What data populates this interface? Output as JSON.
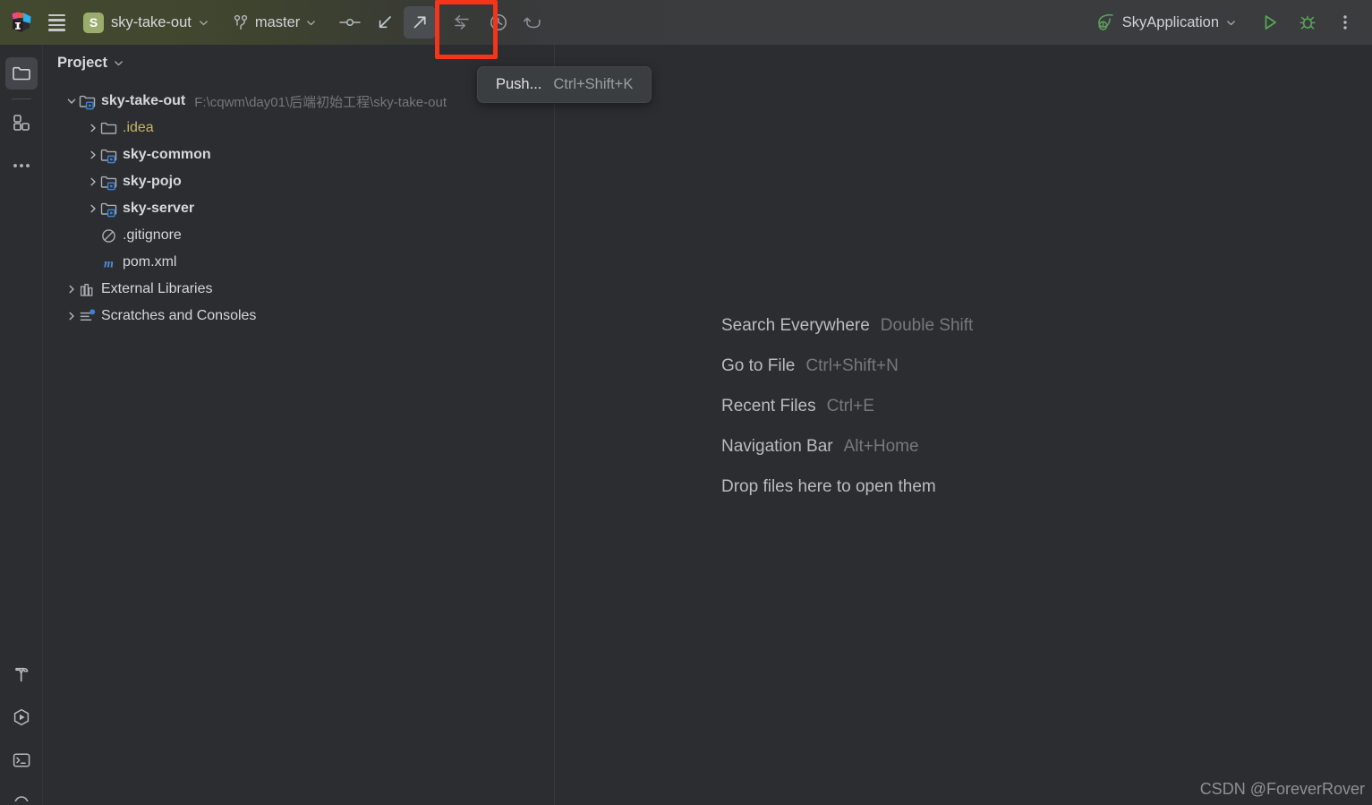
{
  "toolbar": {
    "logo_icon": "intellij-idea-logo",
    "menu_icon": "hamburger-menu-icon",
    "project_badge_letter": "S",
    "project_name": "sky-take-out",
    "branch_icon": "vcs-branch-icon",
    "branch_name": "master",
    "commit_icon": "vcs-commit-icon",
    "update_icon": "vcs-update-project-icon",
    "push_icon": "vcs-push-icon",
    "pull_requests_icon": "vcs-pull-arrows-icon",
    "history_icon": "vcs-history-clock-icon",
    "rollback_icon": "vcs-rollback-icon",
    "run_config_icon": "spring-boot-leaf-icon",
    "run_config_name": "SkyApplication",
    "run_icon": "run-play-icon",
    "debug_icon": "debug-bug-icon",
    "more_icon": "more-vertical-dots-icon",
    "chevron_icon": "chevron-down-icon"
  },
  "tooltip": {
    "label": "Push...",
    "shortcut": "Ctrl+Shift+K"
  },
  "annotation": {
    "color": "#f4351b",
    "target": "vcs-push-button"
  },
  "stripe": {
    "top_items": [
      {
        "name": "sidebar-item-project",
        "icon": "folder-icon",
        "active": true
      },
      {
        "name": "sidebar-item-structure",
        "icon": "four-squares-icon",
        "active": false
      },
      {
        "name": "sidebar-item-more",
        "icon": "ellipsis-icon",
        "active": false
      }
    ],
    "bottom_items": [
      {
        "name": "sidebar-item-build",
        "icon": "hammer-icon",
        "active": false
      },
      {
        "name": "sidebar-item-services",
        "icon": "hexagon-play-icon",
        "active": false
      },
      {
        "name": "sidebar-item-terminal",
        "icon": "terminal-icon",
        "active": false
      },
      {
        "name": "sidebar-item-partial",
        "icon": "circle-icon",
        "active": false
      }
    ]
  },
  "panel": {
    "title": "Project",
    "chevron_icon": "chevron-down-icon",
    "tree": [
      {
        "label": "sky-take-out",
        "path": "F:\\cqwm\\day01\\后端初始工程\\sky-take-out",
        "icon": "module-folder-icon",
        "twisty": "expanded",
        "indent": 0,
        "bold": true
      },
      {
        "label": ".idea",
        "icon": "folder-icon",
        "twisty": "collapsed",
        "indent": 1,
        "bold": false,
        "excluded": true
      },
      {
        "label": "sky-common",
        "icon": "module-folder-icon",
        "twisty": "collapsed",
        "indent": 1,
        "bold": true
      },
      {
        "label": "sky-pojo",
        "icon": "module-folder-icon",
        "twisty": "collapsed",
        "indent": 1,
        "bold": true
      },
      {
        "label": "sky-server",
        "icon": "module-folder-icon",
        "twisty": "collapsed",
        "indent": 1,
        "bold": true
      },
      {
        "label": ".gitignore",
        "icon": "gitignore-circle-slash-icon",
        "twisty": "none",
        "indent": 1,
        "bold": false
      },
      {
        "label": "pom.xml",
        "icon": "maven-m-icon",
        "twisty": "none",
        "indent": 1,
        "bold": false
      },
      {
        "label": "External Libraries",
        "icon": "libraries-books-icon",
        "twisty": "collapsed",
        "indent": 0,
        "bold": false
      },
      {
        "label": "Scratches and Consoles",
        "icon": "scratches-icon",
        "twisty": "collapsed",
        "indent": 0,
        "bold": false
      }
    ]
  },
  "editor": {
    "hints": [
      {
        "label": "Search Everywhere",
        "keys": "Double Shift"
      },
      {
        "label": "Go to File",
        "keys": "Ctrl+Shift+N"
      },
      {
        "label": "Recent Files",
        "keys": "Ctrl+E"
      },
      {
        "label": "Navigation Bar",
        "keys": "Alt+Home"
      },
      {
        "label": "Drop files here to open them",
        "keys": ""
      }
    ]
  },
  "watermark": "CSDN @ForeverRover"
}
